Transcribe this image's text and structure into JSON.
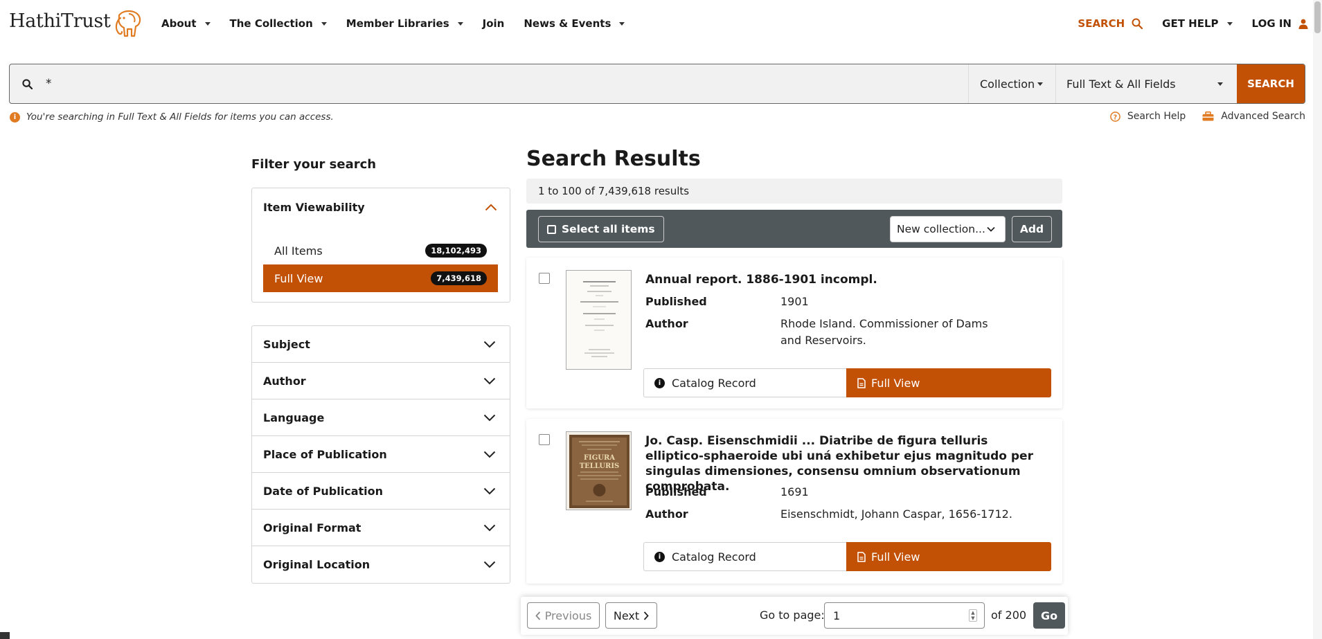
{
  "header": {
    "logo_text": "HathiTrust",
    "nav": [
      {
        "label": "About"
      },
      {
        "label": "The Collection"
      },
      {
        "label": "Member Libraries"
      },
      {
        "label": "Join"
      },
      {
        "label": "News & Events"
      }
    ],
    "search_label": "SEARCH",
    "help_label": "GET HELP",
    "login_label": "LOG IN",
    "accent_color": "#c25106"
  },
  "search": {
    "query": "*",
    "collection_label": "Collection",
    "field_label": "Full Text & All Fields",
    "submit_label": "SEARCH"
  },
  "notice": {
    "text": "You're searching in Full Text & All Fields for items you can access.",
    "search_help": "Search Help",
    "advanced_search": "Advanced Search"
  },
  "sidebar": {
    "title": "Filter your search",
    "viewability": {
      "title": "Item Viewability",
      "options": [
        {
          "label": "All Items",
          "count": "18,102,493"
        },
        {
          "label": "Full View",
          "count": "7,439,618"
        }
      ]
    },
    "facets": [
      {
        "label": "Subject"
      },
      {
        "label": "Author"
      },
      {
        "label": "Language"
      },
      {
        "label": "Place of Publication"
      },
      {
        "label": "Date of Publication"
      },
      {
        "label": "Original Format"
      },
      {
        "label": "Original Location"
      }
    ]
  },
  "results": {
    "title": "Search Results",
    "count_text": "1 to 100 of 7,439,618 results",
    "toolbar": {
      "select_all": "Select all items",
      "collection_select": "New collection...",
      "add_label": "Add"
    },
    "items": [
      {
        "title": "Annual report. 1886-1901 incompl.",
        "published_label": "Published",
        "published": "1901",
        "author_label": "Author",
        "author": "Rhode Island. Commissioner of Dams and Reservoirs.",
        "catalog_label": "Catalog Record",
        "fullview_label": "Full View"
      },
      {
        "title": "Jo. Casp. Eisenschmidii ... Diatribe de figura telluris elliptico-sphaeroide ubi uná exhibetur ejus magnitudo per singulas dimensiones, consensu omnium observationum comprobata.",
        "published_label": "Published",
        "published": "1691",
        "author_label": "Author",
        "author": "Eisenschmidt, Johann Caspar, 1656-1712.",
        "catalog_label": "Catalog Record",
        "fullview_label": "Full View"
      }
    ]
  },
  "pager": {
    "previous": "Previous",
    "next": "Next",
    "goto_label": "Go to page:",
    "page_value": "1",
    "of_text": "of 200",
    "go_label": "Go"
  }
}
